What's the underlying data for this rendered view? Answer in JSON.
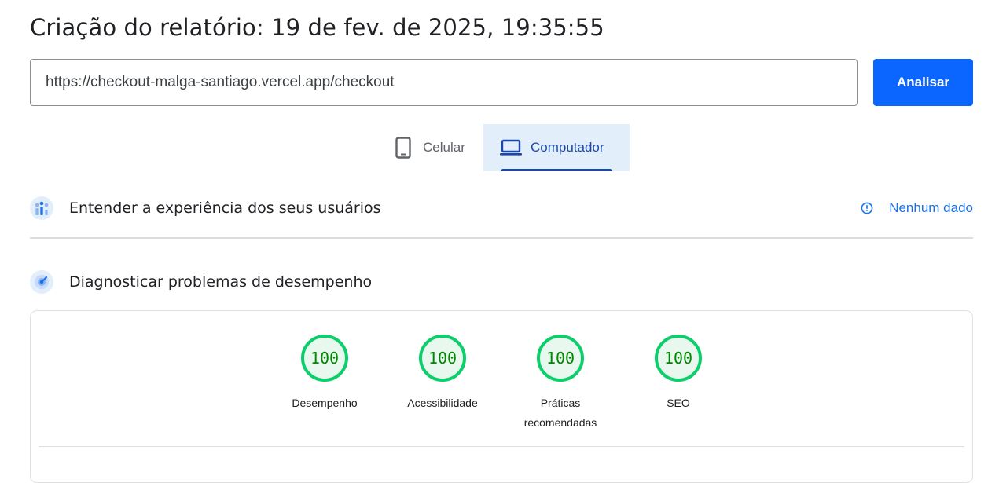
{
  "header": {
    "title": "Criação do relatório: 19 de fev. de 2025, 19:35:55"
  },
  "url_bar": {
    "value": "https://checkout-malga-santiago.vercel.app/checkout",
    "button_label": "Analisar"
  },
  "device_tabs": [
    {
      "label": "Celular",
      "icon": "mobile-phone-icon",
      "selected": false
    },
    {
      "label": "Computador",
      "icon": "laptop-icon",
      "selected": true
    }
  ],
  "ux_section": {
    "icon": "users-chart-icon",
    "title": "Entender a experiência dos seus usuários",
    "status_label": "Nenhum dado",
    "status_icon": "info-icon"
  },
  "diagnostics_section": {
    "icon": "performance-gauge-icon",
    "title": "Diagnosticar problemas de desempenho"
  },
  "scores": [
    {
      "label": "Desempenho",
      "value": "100"
    },
    {
      "label": "Acessibilidade",
      "value": "100"
    },
    {
      "label": "Práticas recomendadas",
      "value": "100"
    },
    {
      "label": "SEO",
      "value": "100"
    }
  ],
  "colors": {
    "accent": "#0a66ff",
    "selected_tab_bg": "#e3eefb",
    "selected_tab_text": "#1a47a8",
    "link": "#1a73e8",
    "score_pass_ring": "#0cce6b",
    "score_pass_text": "#008800"
  }
}
